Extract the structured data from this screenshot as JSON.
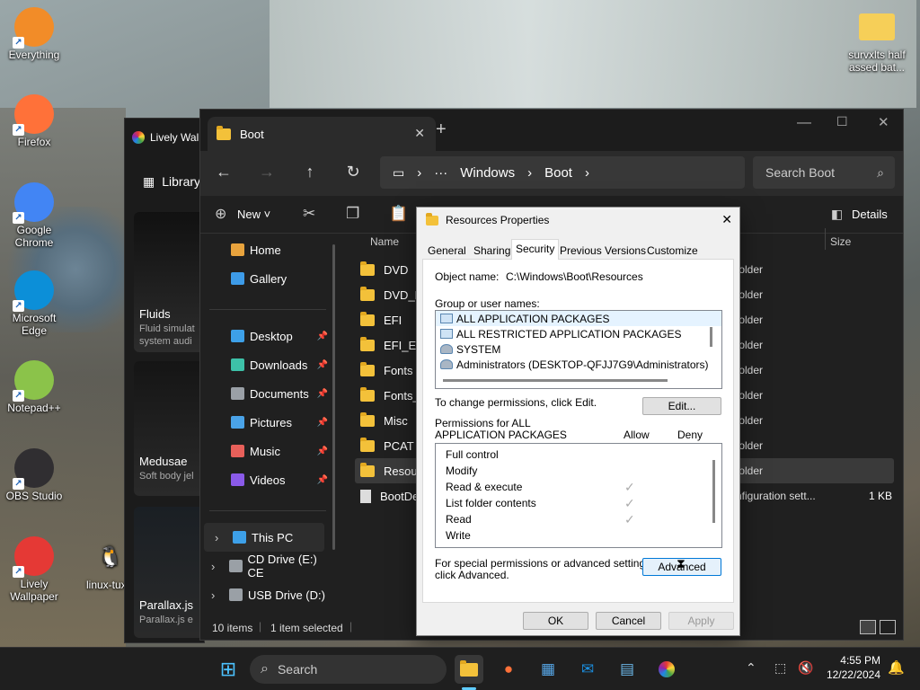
{
  "desktop": {
    "icons_left": [
      {
        "label": "Everything",
        "icon": "everything-icon",
        "color": "#f28c28"
      },
      {
        "label": "Firefox",
        "icon": "firefox-icon",
        "color": "#ff7139"
      },
      {
        "label": "Google Chrome",
        "icon": "chrome-icon",
        "color": "#4285f4"
      },
      {
        "label": "Microsoft Edge",
        "icon": "edge-icon",
        "color": "#0c8fd8"
      },
      {
        "label": "Notepad++",
        "icon": "notepadpp-icon",
        "color": "#8bc34a"
      },
      {
        "label": "OBS Studio",
        "icon": "obs-icon",
        "color": "#302e31"
      },
      {
        "label": "Lively Wallpaper",
        "icon": "lively-icon",
        "color": "#e53935"
      }
    ],
    "linux_icon": {
      "label": "linux-tux.c",
      "icon": "tux-icon"
    },
    "top_right_icon": {
      "label": "survxlts half assed bat...",
      "icon": "folder-icon"
    }
  },
  "lively": {
    "title": "Lively Wall",
    "library": "Library",
    "cards": [
      {
        "title": "Fluids",
        "sub": "Fluid simulat",
        "sub2": "system audi"
      },
      {
        "title": "Medusae",
        "sub": "Soft body jel"
      },
      {
        "title": "Parallax.js",
        "sub": "Parallax.js e"
      }
    ]
  },
  "explorer": {
    "tab_title": "Boot",
    "breadcrumb": [
      "Windows",
      "Boot"
    ],
    "search_placeholder": "Search Boot",
    "toolbar": {
      "new_label": "New",
      "details_label": "Details"
    },
    "sidebar": [
      {
        "label": "Home",
        "icon": "home-icon",
        "pinned": false
      },
      {
        "label": "Gallery",
        "icon": "gallery-icon",
        "pinned": false
      },
      {
        "label": "Desktop",
        "icon": "desktop-icon",
        "pinned": true
      },
      {
        "label": "Downloads",
        "icon": "download-icon",
        "pinned": true
      },
      {
        "label": "Documents",
        "icon": "documents-icon",
        "pinned": true
      },
      {
        "label": "Pictures",
        "icon": "pictures-icon",
        "pinned": true
      },
      {
        "label": "Music",
        "icon": "music-icon",
        "pinned": true
      },
      {
        "label": "Videos",
        "icon": "videos-icon",
        "pinned": true
      },
      {
        "label": "This PC",
        "icon": "pc-icon",
        "pinned": false
      },
      {
        "label": "CD Drive (E:) CE",
        "icon": "cd-icon",
        "pinned": false
      },
      {
        "label": "USB Drive (D:)",
        "icon": "usb-icon",
        "pinned": false
      }
    ],
    "columns": {
      "name": "Name",
      "size": "Size"
    },
    "files": [
      {
        "name": "DVD",
        "type": "folder"
      },
      {
        "name": "DVD_EX",
        "type": "folder"
      },
      {
        "name": "EFI",
        "type": "folder"
      },
      {
        "name": "EFI_EX",
        "type": "folder"
      },
      {
        "name": "Fonts",
        "type": "folder"
      },
      {
        "name": "Fonts_E",
        "type": "folder"
      },
      {
        "name": "Misc",
        "type": "folder"
      },
      {
        "name": "PCAT",
        "type": "folder"
      },
      {
        "name": "Resourc",
        "type": "folder",
        "selected": true
      },
      {
        "name": "BootDel",
        "type": "nfiguration sett...",
        "size": "1 KB"
      }
    ],
    "status": {
      "count": "10 items",
      "selected": "1 item selected"
    }
  },
  "dialog": {
    "title": "Resources Properties",
    "tabs": [
      "General",
      "Sharing",
      "Security",
      "Previous Versions",
      "Customize"
    ],
    "active_tab": "Security",
    "object_label": "Object name:",
    "object_value": "C:\\Windows\\Boot\\Resources",
    "group_label": "Group or user names:",
    "groups": [
      "ALL APPLICATION PACKAGES",
      "ALL RESTRICTED APPLICATION PACKAGES",
      "SYSTEM",
      "Administrators (DESKTOP-QFJJ7G9\\Administrators)"
    ],
    "change_text": "To change permissions, click Edit.",
    "edit_btn": "Edit...",
    "perm_label_1": "Permissions for ALL",
    "perm_label_2": "APPLICATION PACKAGES",
    "allow": "Allow",
    "deny": "Deny",
    "permissions": [
      {
        "name": "Full control",
        "allow": false
      },
      {
        "name": "Modify",
        "allow": false
      },
      {
        "name": "Read & execute",
        "allow": true
      },
      {
        "name": "List folder contents",
        "allow": true
      },
      {
        "name": "Read",
        "allow": true
      },
      {
        "name": "Write",
        "allow": false
      }
    ],
    "special_text_1": "For special permissions or advanced settings,",
    "special_text_2": "click Advanced.",
    "advanced_btn": "Advanced",
    "ok": "OK",
    "cancel": "Cancel",
    "apply": "Apply"
  },
  "taskbar": {
    "search": "Search",
    "time": "4:55 PM",
    "date": "12/22/2024"
  }
}
